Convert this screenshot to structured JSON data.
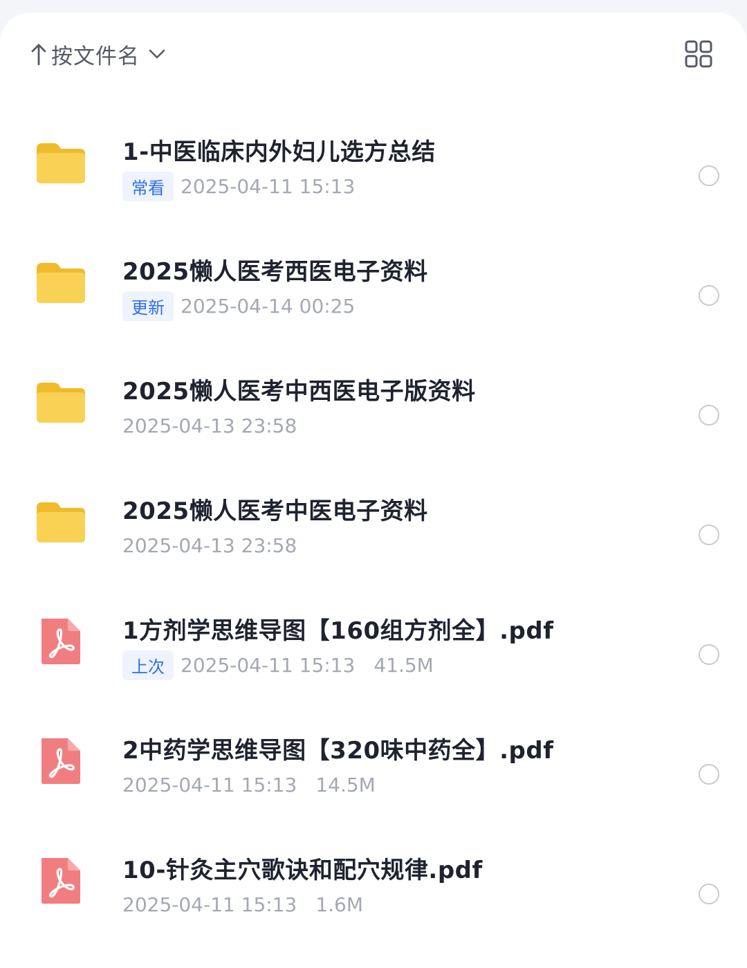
{
  "toolbar": {
    "sort_label": "按文件名",
    "sort_direction_icon": "arrow-up-icon",
    "sort_menu_icon": "chevron-down-icon",
    "view_toggle_icon": "grid-view-icon"
  },
  "colors": {
    "folder": "#f9cf4a",
    "pdf": "#f07e80",
    "tag_bg": "#eef3fd",
    "tag_text": "#2f6fe8",
    "title_text": "#1f2330",
    "meta_text": "#a4a8b3"
  },
  "files": [
    {
      "type": "folder",
      "icon": "folder-icon",
      "name": "1-中医临床内外妇儿选方总结",
      "tag": "常看",
      "date": "2025-04-11 15:13",
      "size": ""
    },
    {
      "type": "folder",
      "icon": "folder-icon",
      "name": "2025懒人医考西医电子资料",
      "tag": "更新",
      "date": "2025-04-14 00:25",
      "size": ""
    },
    {
      "type": "folder",
      "icon": "folder-icon",
      "name": "2025懒人医考中西医电子版资料",
      "tag": "",
      "date": "2025-04-13 23:58",
      "size": ""
    },
    {
      "type": "folder",
      "icon": "folder-icon",
      "name": "2025懒人医考中医电子资料",
      "tag": "",
      "date": "2025-04-13 23:58",
      "size": ""
    },
    {
      "type": "pdf",
      "icon": "pdf-icon",
      "name": "1方剂学思维导图【160组方剂全】.pdf",
      "tag": "上次",
      "date": "2025-04-11 15:13",
      "size": "41.5M"
    },
    {
      "type": "pdf",
      "icon": "pdf-icon",
      "name": "2中药学思维导图【320味中药全】.pdf",
      "tag": "",
      "date": "2025-04-11 15:13",
      "size": "14.5M"
    },
    {
      "type": "pdf",
      "icon": "pdf-icon",
      "name": "10-针灸主穴歌诀和配穴规律.pdf",
      "tag": "",
      "date": "2025-04-11 15:13",
      "size": "1.6M"
    }
  ]
}
